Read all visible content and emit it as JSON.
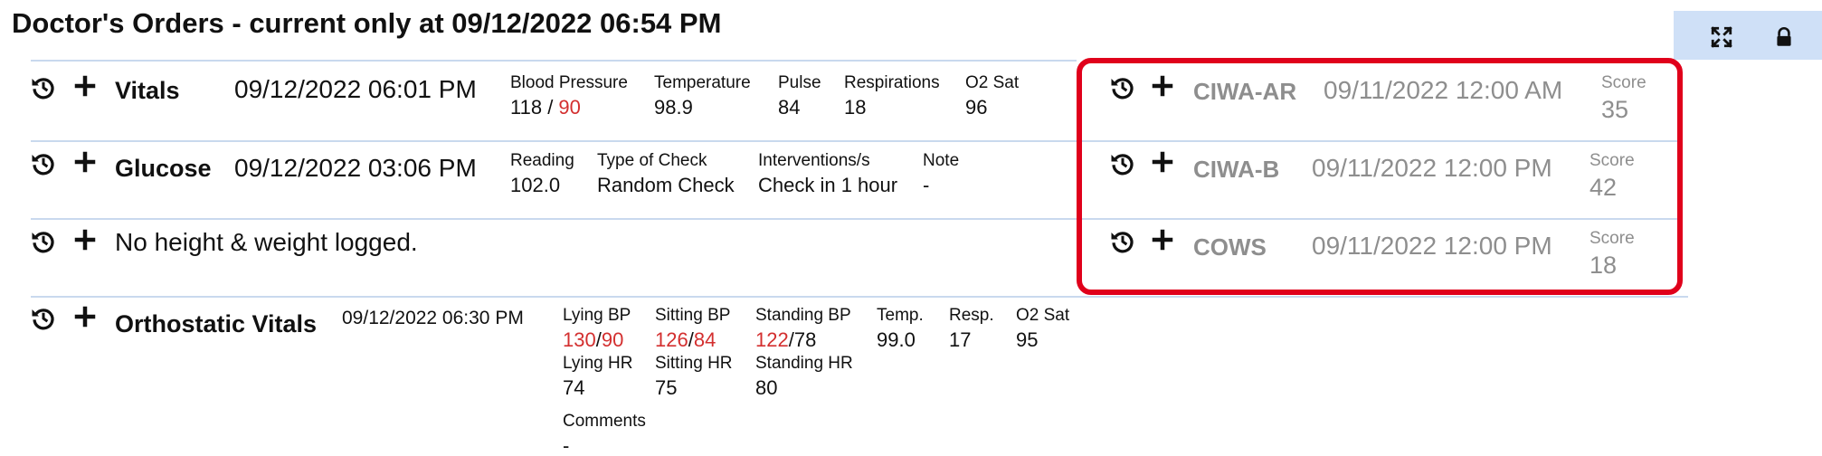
{
  "header": {
    "title": "Doctor's Orders - current only at 09/12/2022 06:54 PM"
  },
  "icons": {
    "history": "history-icon",
    "add": "plus-icon",
    "expand": "expand-icon",
    "lock": "lock-icon"
  },
  "vitals": {
    "title": "Vitals",
    "date": "09/12/2022 06:01 PM",
    "bp_label": "Blood Pressure",
    "bp_systolic": "118",
    "bp_sep": " / ",
    "bp_diastolic": "90",
    "temp_label": "Temperature",
    "temp_value": "98.9",
    "pulse_label": "Pulse",
    "pulse_value": "84",
    "resp_label": "Respirations",
    "resp_value": "18",
    "o2_label": "O2 Sat",
    "o2_value": "96"
  },
  "glucose": {
    "title": "Glucose",
    "date": "09/12/2022 03:06 PM",
    "reading_label": "Reading",
    "reading_value": "102.0",
    "type_label": "Type of Check",
    "type_value": "Random Check",
    "interventions_label": "Interventions/s",
    "interventions_value": "Check in 1 hour",
    "note_label": "Note",
    "note_value": "-"
  },
  "height_weight": {
    "text": "No height & weight logged."
  },
  "orthostatic": {
    "title": "Orthostatic Vitals",
    "date": "09/12/2022 06:30 PM",
    "lying_bp_label": "Lying BP",
    "lying_bp_sys": "130",
    "lying_bp_dia": "90",
    "sitting_bp_label": "Sitting BP",
    "sitting_bp_sys": "126",
    "sitting_bp_dia": "84",
    "standing_bp_label": "Standing BP",
    "standing_bp_sys": "122",
    "standing_bp_dia": "78",
    "bp_sep": "/",
    "temp_label": "Temp.",
    "temp_value": "99.0",
    "resp_label": "Resp.",
    "resp_value": "17",
    "o2_label": "O2 Sat",
    "o2_value": "95",
    "lying_hr_label": "Lying HR",
    "lying_hr_value": "74",
    "sitting_hr_label": "Sitting HR",
    "sitting_hr_value": "75",
    "standing_hr_label": "Standing HR",
    "standing_hr_value": "80",
    "comments_label": "Comments",
    "comments_value": "-"
  },
  "scores": [
    {
      "title": "CIWA-AR",
      "date": "09/11/2022 12:00 AM",
      "score_label": "Score",
      "score_value": "35"
    },
    {
      "title": "CIWA-B",
      "date": "09/11/2022 12:00 PM",
      "score_label": "Score",
      "score_value": "42"
    },
    {
      "title": "COWS",
      "date": "09/11/2022 12:00 PM",
      "score_label": "Score",
      "score_value": "18"
    }
  ],
  "colors": {
    "accent_red": "#d32f2f",
    "highlight_border": "#e0001b",
    "divider": "#c9d9ee",
    "muted_text": "#8e8e8e",
    "control_bg": "#cfe0f7"
  }
}
